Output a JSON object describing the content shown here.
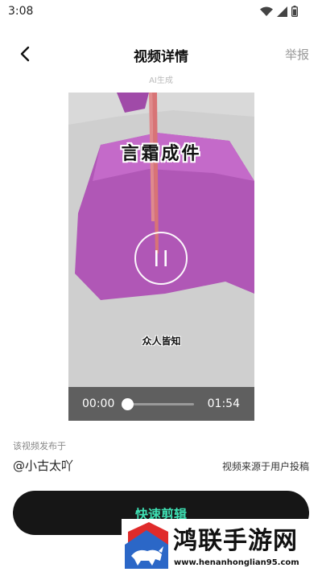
{
  "status_bar": {
    "time": "3:08",
    "icons": [
      "wifi-icon",
      "signal-icon",
      "battery-icon"
    ]
  },
  "nav": {
    "title": "视频详情",
    "report_label": "举报",
    "back_icon": "chevron-left-icon"
  },
  "ai_label": "AI生成",
  "video": {
    "caption_top": "言霜成件",
    "caption_bottom": "众人皆知",
    "current_time": "00:00",
    "total_time": "01:54",
    "progress_fraction": 0.02,
    "pause_icon": "pause-icon",
    "object_color": "#b057b6",
    "background_color": "#cfcfcf"
  },
  "info": {
    "published_label": "该视频发布于",
    "author": "@小古太吖",
    "source_note": "视频来源于用户投稿"
  },
  "edit_button": {
    "label": "快速剪辑",
    "accent_color": "#3ee0b3"
  },
  "watermark": {
    "title": "鸿联手游网",
    "url": "www.henanhonglian95.com",
    "logo": "bull-logo"
  }
}
